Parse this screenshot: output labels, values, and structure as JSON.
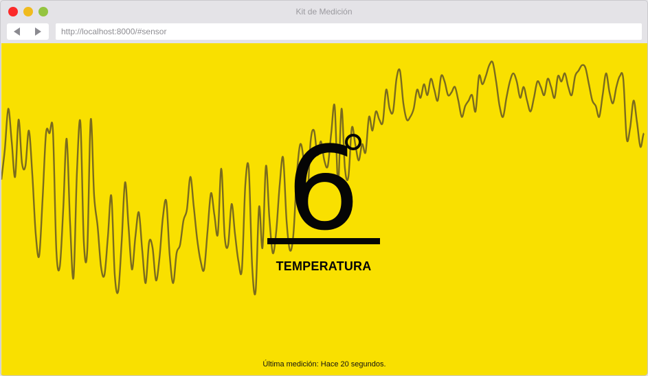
{
  "window": {
    "title": "Kit de Medición"
  },
  "toolbar": {
    "url": "http://localhost:8000/#sensor"
  },
  "sensor": {
    "value": "6",
    "label": "TEMPERATURA",
    "status": "Última medición: Hace 20 segundos."
  },
  "colors": {
    "background": "#f9e000",
    "line": "#7a6b1e",
    "text": "#050505"
  },
  "chart_data": {
    "type": "line",
    "x": [
      0,
      1,
      2,
      3,
      4,
      5,
      6,
      7,
      8,
      9,
      10,
      11,
      12,
      13,
      14,
      15,
      16,
      17,
      18,
      19,
      20,
      21,
      22,
      23,
      24,
      25,
      26,
      27,
      28,
      29,
      30,
      31,
      32,
      33,
      34,
      35,
      36,
      37,
      38,
      39,
      40,
      41,
      42,
      43,
      44,
      45,
      46,
      47,
      48,
      49,
      50,
      51,
      52,
      53,
      54,
      55,
      56,
      57,
      58,
      59,
      60,
      61,
      62,
      63,
      64,
      65,
      66,
      67,
      68,
      69,
      70,
      71,
      72,
      73,
      74,
      75,
      76,
      77,
      78,
      79,
      80,
      81,
      82,
      83,
      84,
      85,
      86,
      87,
      88,
      89,
      90,
      91,
      92,
      93,
      94,
      95,
      96,
      97,
      98,
      99,
      100,
      101,
      102,
      103,
      104,
      105,
      106,
      107,
      108,
      109,
      110,
      111,
      112,
      113,
      114,
      115,
      116,
      117,
      118,
      119,
      120,
      121,
      122,
      123,
      124,
      125,
      126,
      127,
      128,
      129,
      130,
      131,
      132,
      133,
      134,
      135,
      136,
      137,
      138,
      139,
      140,
      141,
      142,
      143,
      144,
      145,
      146,
      147,
      148,
      149,
      150,
      151,
      152,
      153,
      154,
      155,
      156,
      157,
      158,
      159,
      160,
      161,
      162,
      163,
      164,
      165,
      166,
      167,
      168,
      169,
      170,
      171,
      172,
      173,
      174,
      175,
      176,
      177,
      178,
      179,
      180,
      181,
      182,
      183,
      184,
      185,
      186,
      187,
      188
    ],
    "values": [
      0.57,
      0.68,
      0.83,
      0.71,
      0.58,
      0.79,
      0.63,
      0.62,
      0.75,
      0.59,
      0.37,
      0.29,
      0.5,
      0.74,
      0.74,
      0.75,
      0.31,
      0.25,
      0.46,
      0.72,
      0.41,
      0.21,
      0.6,
      0.78,
      0.34,
      0.31,
      0.79,
      0.51,
      0.4,
      0.25,
      0.22,
      0.36,
      0.51,
      0.22,
      0.16,
      0.34,
      0.56,
      0.4,
      0.24,
      0.36,
      0.45,
      0.31,
      0.19,
      0.34,
      0.32,
      0.2,
      0.28,
      0.43,
      0.49,
      0.29,
      0.19,
      0.3,
      0.33,
      0.42,
      0.46,
      0.58,
      0.47,
      0.35,
      0.27,
      0.24,
      0.38,
      0.52,
      0.44,
      0.37,
      0.61,
      0.36,
      0.33,
      0.48,
      0.37,
      0.27,
      0.24,
      0.55,
      0.61,
      0.25,
      0.16,
      0.47,
      0.32,
      0.62,
      0.43,
      0.3,
      0.38,
      0.55,
      0.65,
      0.42,
      0.31,
      0.37,
      0.59,
      0.7,
      0.64,
      0.5,
      0.71,
      0.75,
      0.66,
      0.71,
      0.64,
      0.62,
      0.74,
      0.84,
      0.56,
      0.83,
      0.61,
      0.58,
      0.76,
      0.7,
      0.64,
      0.7,
      0.67,
      0.8,
      0.75,
      0.82,
      0.79,
      0.78,
      0.9,
      0.83,
      0.82,
      0.94,
      0.97,
      0.85,
      0.79,
      0.8,
      0.83,
      0.9,
      0.87,
      0.92,
      0.88,
      0.94,
      0.9,
      0.86,
      0.95,
      0.93,
      0.88,
      0.89,
      0.91,
      0.86,
      0.8,
      0.84,
      0.86,
      0.88,
      0.82,
      0.95,
      0.92,
      0.95,
      0.99,
      1.0,
      0.93,
      0.84,
      0.8,
      0.87,
      0.93,
      0.96,
      0.93,
      0.87,
      0.91,
      0.86,
      0.82,
      0.87,
      0.93,
      0.91,
      0.88,
      0.94,
      0.91,
      0.87,
      0.95,
      0.93,
      0.96,
      0.91,
      0.88,
      0.95,
      0.97,
      0.99,
      0.98,
      0.92,
      0.86,
      0.84,
      0.8,
      0.88,
      0.96,
      0.89,
      0.85,
      0.91,
      0.95,
      0.94,
      0.72,
      0.76,
      0.86,
      0.78,
      0.69,
      0.74,
      0.71,
      0.83,
      0.78,
      0.7,
      0.68
    ]
  }
}
